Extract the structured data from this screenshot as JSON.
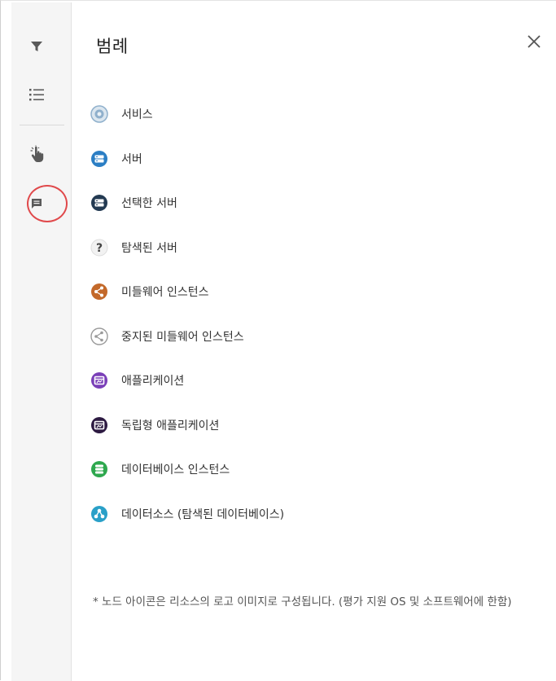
{
  "panel": {
    "title": "범례",
    "close_icon": "close-icon"
  },
  "rail": {
    "items": [
      {
        "icon": "filter-icon"
      },
      {
        "icon": "list-icon"
      },
      {
        "icon": "pointer-hand-icon"
      },
      {
        "icon": "legend-comment-icon",
        "highlighted": true
      }
    ]
  },
  "legend": {
    "items": [
      {
        "label": "서비스",
        "icon": "service-icon",
        "color": "#8fb0cc"
      },
      {
        "label": "서버",
        "icon": "server-icon",
        "color": "#2b7ec4"
      },
      {
        "label": "선택한 서버",
        "icon": "selected-server-icon",
        "color": "#233a52"
      },
      {
        "label": "탐색된 서버",
        "icon": "discovered-server-icon",
        "color": "#555555"
      },
      {
        "label": "미들웨어 인스턴스",
        "icon": "middleware-instance-icon",
        "color": "#c3692a"
      },
      {
        "label": "중지된 미들웨어 인스턴스",
        "icon": "stopped-middleware-instance-icon",
        "color": "#9a9a9a"
      },
      {
        "label": "애플리케이션",
        "icon": "application-icon",
        "color": "#7a3fb8"
      },
      {
        "label": "독립형 애플리케이션",
        "icon": "standalone-application-icon",
        "color": "#2d1a42"
      },
      {
        "label": "데이터베이스 인스턴스",
        "icon": "database-instance-icon",
        "color": "#2ea84e"
      },
      {
        "label": "데이터소스 (탐색된 데이터베이스)",
        "icon": "datasource-icon",
        "color": "#2aa0c8"
      }
    ]
  },
  "footnote": "* 노드 아이콘은 리소스의 로고 이미지로 구성됩니다. (평가 지원 OS 및 소프트웨어에 한함)"
}
